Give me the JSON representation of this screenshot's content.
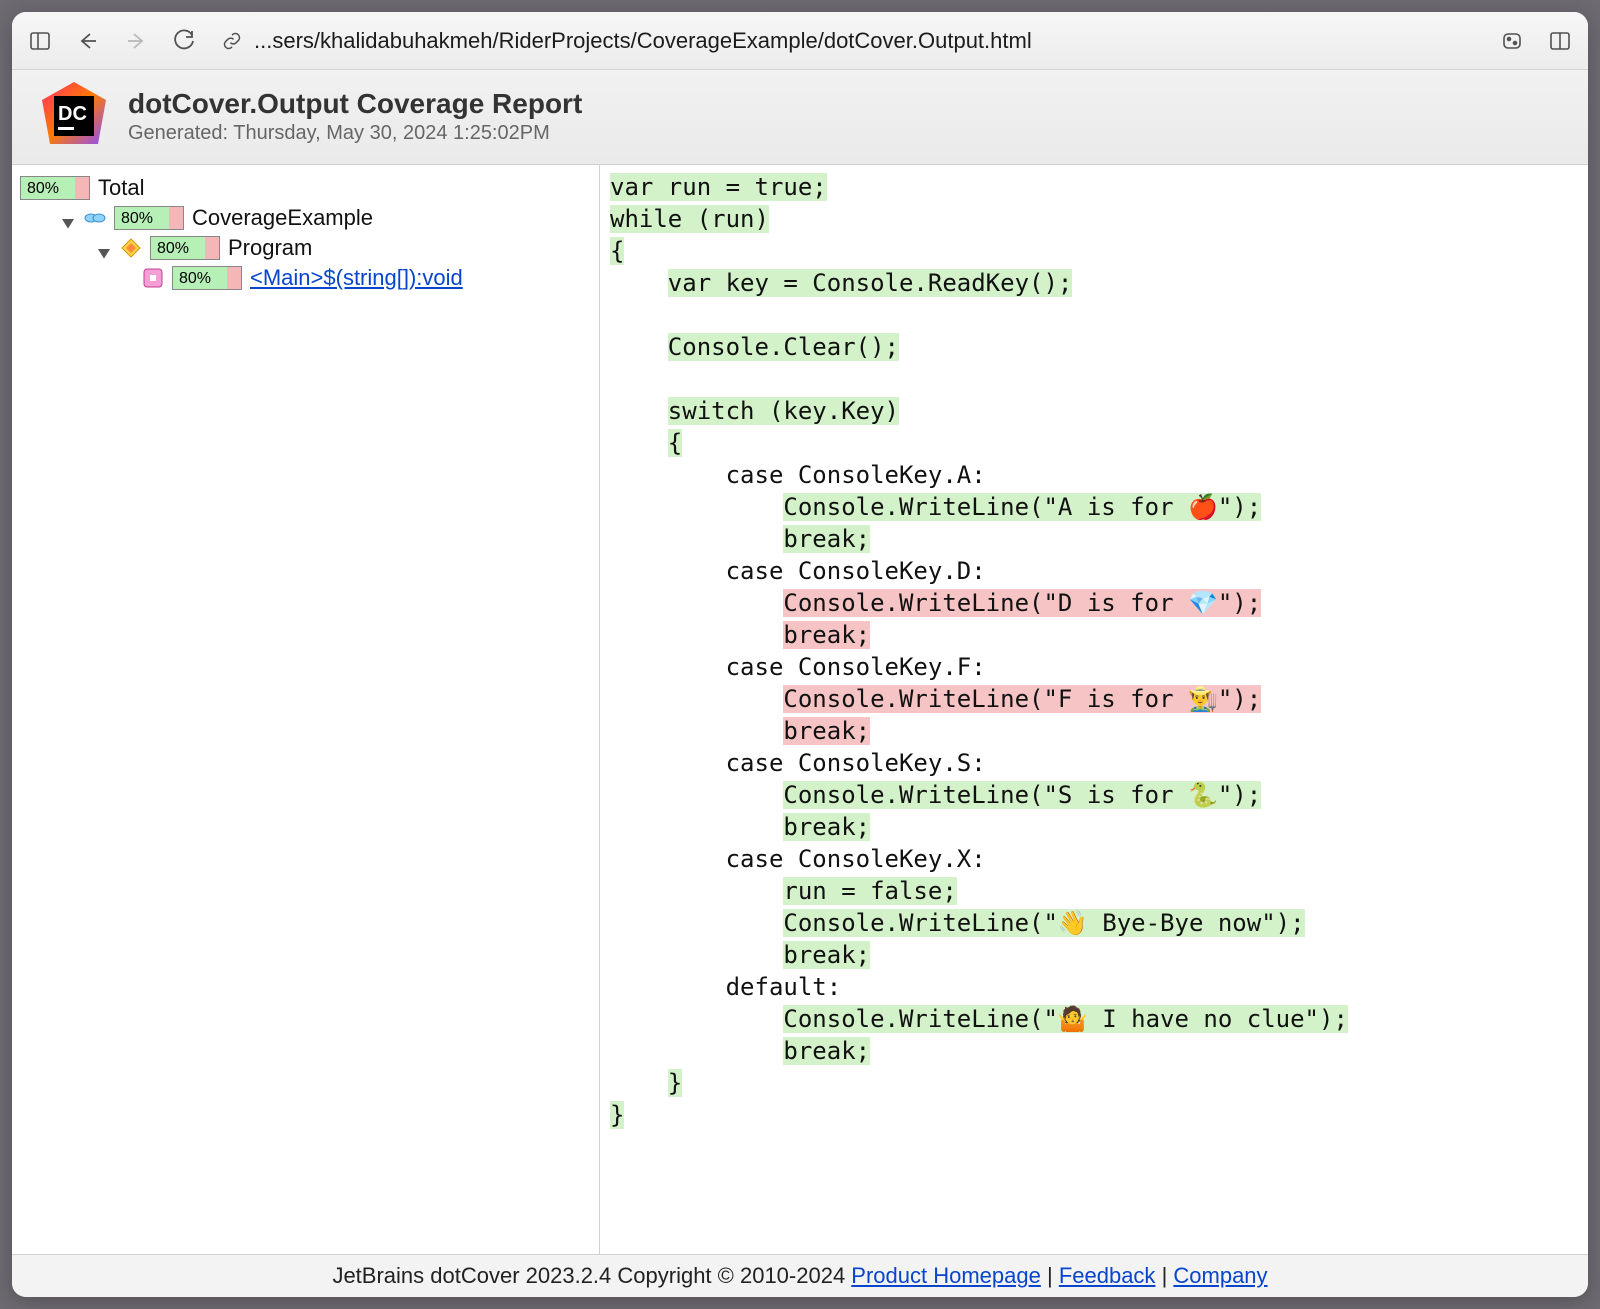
{
  "toolbar": {
    "path": "...sers/khalidabuhakmeh/RiderProjects/CoverageExample/dotCover.Output.html"
  },
  "header": {
    "title": "dotCover.Output Coverage Report",
    "subtitle": "Generated: Thursday, May 30, 2024 1:25:02PM"
  },
  "tree": {
    "total": {
      "pct": "80%",
      "label": "Total"
    },
    "project": {
      "pct": "80%",
      "label": "CoverageExample"
    },
    "program": {
      "pct": "80%",
      "label": "Program"
    },
    "method": {
      "pct": "80%",
      "label": "<Main>$(string[]):void"
    }
  },
  "code_lines": [
    {
      "segments": [
        {
          "t": "var run = true;",
          "c": "g"
        }
      ]
    },
    {
      "segments": [
        {
          "t": "while (run)",
          "c": "g"
        }
      ]
    },
    {
      "segments": [
        {
          "t": "{",
          "c": "g"
        }
      ]
    },
    {
      "segments": [
        {
          "t": "    "
        },
        {
          "t": "var key = Console.ReadKey();",
          "c": "g"
        }
      ]
    },
    {
      "segments": [
        {
          "t": ""
        }
      ]
    },
    {
      "segments": [
        {
          "t": "    "
        },
        {
          "t": "Console.Clear();",
          "c": "g"
        }
      ]
    },
    {
      "segments": [
        {
          "t": ""
        }
      ]
    },
    {
      "segments": [
        {
          "t": "    "
        },
        {
          "t": "switch (key.Key)",
          "c": "g"
        }
      ]
    },
    {
      "segments": [
        {
          "t": "    "
        },
        {
          "t": "{",
          "c": "g"
        }
      ]
    },
    {
      "segments": [
        {
          "t": "        case ConsoleKey.A:"
        }
      ]
    },
    {
      "segments": [
        {
          "t": "            "
        },
        {
          "t": "Console.WriteLine(\"A is for 🍎\");",
          "c": "g"
        }
      ]
    },
    {
      "segments": [
        {
          "t": "            "
        },
        {
          "t": "break;",
          "c": "g"
        }
      ]
    },
    {
      "segments": [
        {
          "t": "        case ConsoleKey.D:"
        }
      ]
    },
    {
      "segments": [
        {
          "t": "            "
        },
        {
          "t": "Console.WriteLine(\"D is for 💎\");",
          "c": "r"
        }
      ]
    },
    {
      "segments": [
        {
          "t": "            "
        },
        {
          "t": "break;",
          "c": "r"
        }
      ]
    },
    {
      "segments": [
        {
          "t": "        case ConsoleKey.F:"
        }
      ]
    },
    {
      "segments": [
        {
          "t": "            "
        },
        {
          "t": "Console.WriteLine(\"F is for 👨‍🌾\");",
          "c": "r"
        }
      ]
    },
    {
      "segments": [
        {
          "t": "            "
        },
        {
          "t": "break;",
          "c": "r"
        }
      ]
    },
    {
      "segments": [
        {
          "t": "        case ConsoleKey.S:"
        }
      ]
    },
    {
      "segments": [
        {
          "t": "            "
        },
        {
          "t": "Console.WriteLine(\"S is for 🐍\");",
          "c": "g"
        }
      ]
    },
    {
      "segments": [
        {
          "t": "            "
        },
        {
          "t": "break;",
          "c": "g"
        }
      ]
    },
    {
      "segments": [
        {
          "t": "        case ConsoleKey.X:"
        }
      ]
    },
    {
      "segments": [
        {
          "t": "            "
        },
        {
          "t": "run = false;",
          "c": "g"
        }
      ]
    },
    {
      "segments": [
        {
          "t": "            "
        },
        {
          "t": "Console.WriteLine(\"👋 Bye-Bye now\");",
          "c": "g"
        }
      ]
    },
    {
      "segments": [
        {
          "t": "            "
        },
        {
          "t": "break;",
          "c": "g"
        }
      ]
    },
    {
      "segments": [
        {
          "t": "        default:"
        }
      ]
    },
    {
      "segments": [
        {
          "t": "            "
        },
        {
          "t": "Console.WriteLine(\"🤷 I have no clue\");",
          "c": "g"
        }
      ]
    },
    {
      "segments": [
        {
          "t": "            "
        },
        {
          "t": "break;",
          "c": "g"
        }
      ]
    },
    {
      "segments": [
        {
          "t": "    "
        },
        {
          "t": "}",
          "c": "g"
        }
      ]
    },
    {
      "segments": [
        {
          "t": "}",
          "c": "g"
        }
      ]
    }
  ],
  "footer": {
    "copyright": "JetBrains dotCover 2023.2.4 Copyright © 2010-2024 ",
    "links": {
      "homepage": "Product Homepage",
      "feedback": "Feedback",
      "company": "Company"
    }
  }
}
